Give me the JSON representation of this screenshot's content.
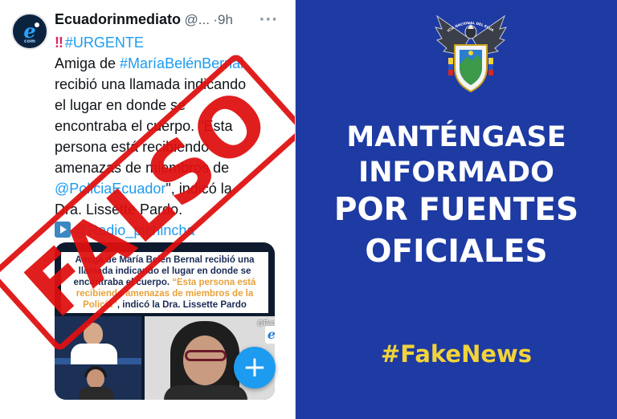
{
  "tweet": {
    "author": "Ecuadorinmediato",
    "handle": "@...",
    "separator": "·",
    "time_ago": "9h",
    "more": "···",
    "avatar_com": "com",
    "alert_icon": "‼",
    "tag_urgente": "#URGENTE",
    "line2_text": "Amiga de ",
    "line2_tag": "#MaríaBelénBernal",
    "line3": "recibió una llamada indicando",
    "line4": "el lugar en donde se",
    "line5": "encontraba el cuerpo. \"Esta",
    "line6": "persona está recibiendo",
    "line7": "amenazas de miembros de",
    "line8_mention": "@PoliciaEcuador",
    "line8_text": "\", indicó la",
    "line9": "Dra. Lissette Pardo.",
    "line10_mention": "@Radio_pichincha",
    "media": {
      "caption_1": "Amiga de María Belén Bernal recibió una llamada indicando el lugar en donde se encontraba el cuerpo. ",
      "caption_2": "“Esta persona está recibiendo amenazas de miembros de la Policía”",
      "caption_3": ", indicó la Dra. Lissette Pardo",
      "station_tag": "@Radio_Pichincha",
      "station_logo": "e"
    },
    "fab_label": "+"
  },
  "stamp": {
    "text": "FALSO",
    "color": "#e01010"
  },
  "banner": {
    "background": "#1e3aa3",
    "crest_text": "POLICÍA NACIONAL DEL ECUADOR",
    "line1": "MANTÉNGASE",
    "line2": "INFORMADO",
    "line3": "POR FUENTES",
    "line4": "OFICIALES",
    "hashtag": "#FakeNews",
    "hashtag_color": "#f2d43a"
  }
}
